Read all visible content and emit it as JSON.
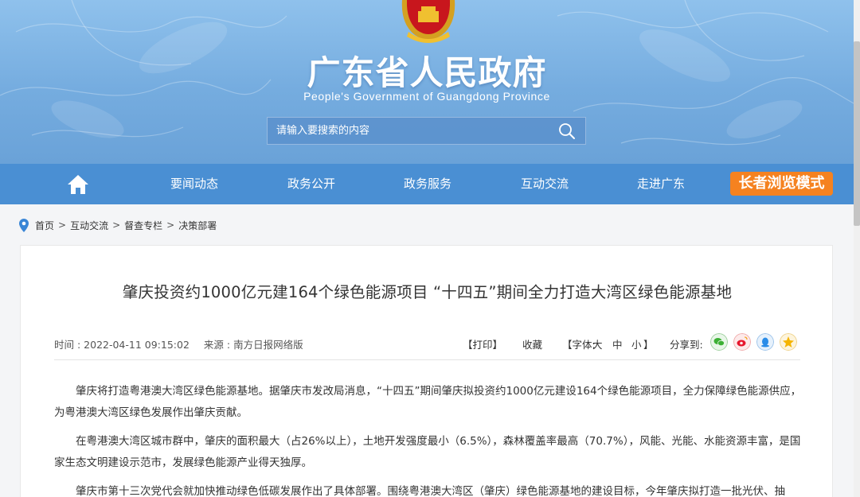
{
  "header": {
    "title": "广东省人民政府",
    "subtitle": "People's Government of Guangdong Province"
  },
  "search": {
    "placeholder": "请输入要搜索的内容"
  },
  "nav": {
    "items": [
      {
        "label": "要闻动态"
      },
      {
        "label": "政务公开"
      },
      {
        "label": "政务服务"
      },
      {
        "label": "互动交流"
      },
      {
        "label": "走进广东"
      }
    ],
    "elder_mode": "长者浏览模式"
  },
  "breadcrumb": {
    "items": [
      "首页",
      "互动交流",
      "督查专栏",
      "决策部署"
    ],
    "separator": ">"
  },
  "article": {
    "title": "肇庆投资约1000亿元建164个绿色能源项目 “十四五”期间全力打造大湾区绿色能源基地",
    "time": "时间 : 2022-04-11 09:15:02",
    "source": "来源 : 南方日报网络版",
    "print": "【打印】",
    "favorite": "收藏",
    "font_label": "【字体:",
    "font_large": "大",
    "font_medium": "中",
    "font_small": "小",
    "font_close": "】",
    "share_label": "分享到:",
    "paragraphs": [
      "肇庆将打造粤港澳大湾区绿色能源基地。据肇庆市发改局消息，“十四五”期间肇庆拟投资约1000亿元建设164个绿色能源项目，全力保障绿色能源供应，为粤港澳大湾区绿色发展作出肇庆贡献。",
      "在粤港澳大湾区城市群中，肇庆的面积最大（占26%以上），土地开发强度最小（6.5%），森林覆盖率最高（70.7%），风能、光能、水能资源丰富，是国家生态文明建设示范市，发展绿色能源产业得天独厚。",
      "肇庆市第十三次党代会就加快推动绿色低碳发展作出了具体部署。围绕粤港澳大湾区（肇庆）绿色能源基地的建设目标，今年肇庆拟打造一批光伏、抽"
    ]
  },
  "colors": {
    "nav_bg": "#4a8fd3",
    "elder_btn": "#f58220",
    "header_bg": "#7fb3e3"
  }
}
